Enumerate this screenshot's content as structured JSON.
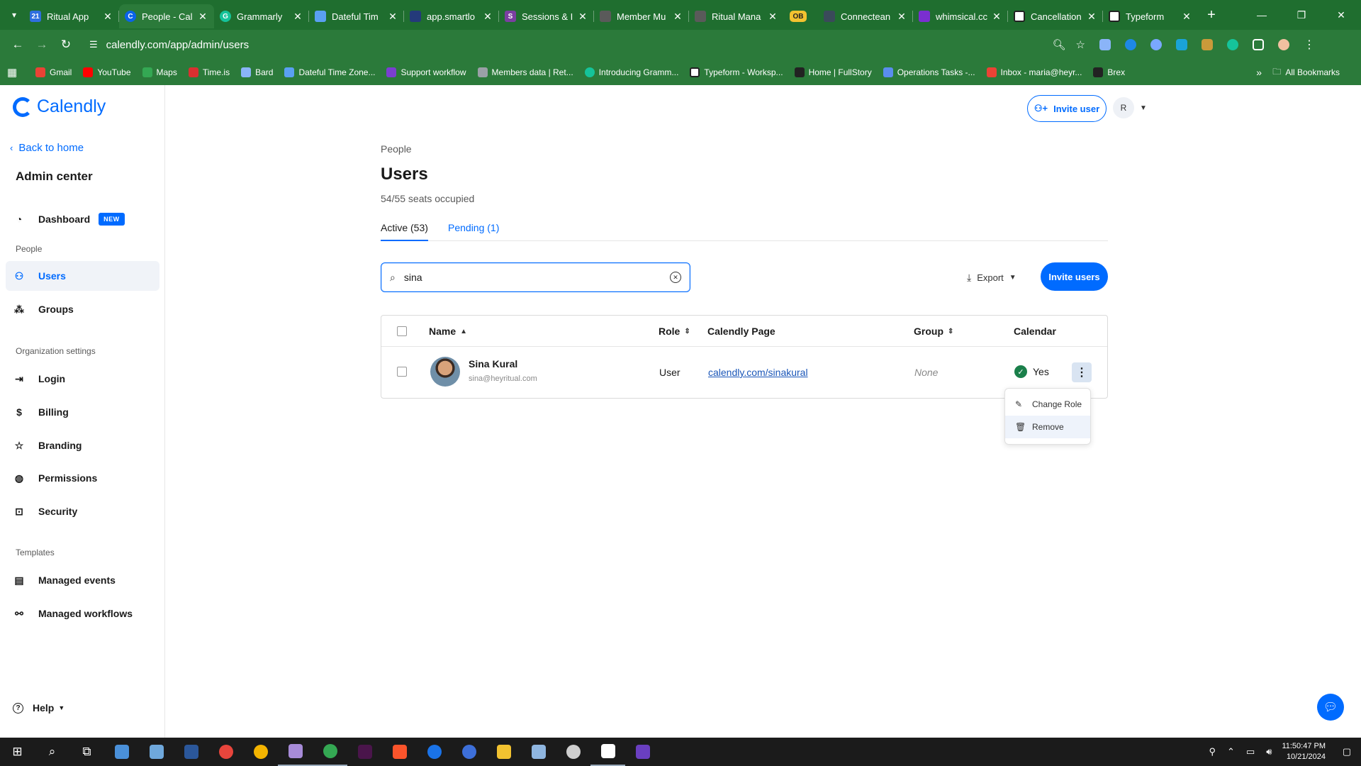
{
  "browser": {
    "tabs": [
      {
        "label": "Ritual App",
        "color": "#2f6fde"
      },
      {
        "label": "People - Cal",
        "color": "#0a63e8",
        "active": true
      },
      {
        "label": "Grammarly",
        "color": "#15c39a"
      },
      {
        "label": "Dateful Tim",
        "color": "#5aa0f2"
      },
      {
        "label": "app.smartlo",
        "color": "#243a7a"
      },
      {
        "label": "Sessions & I",
        "color": "#7a3fa0"
      },
      {
        "label": "Member Mu",
        "color": "#5a5a5a"
      },
      {
        "label": "Ritual Mana",
        "color": "#5a5a5a"
      },
      {
        "label": "OB",
        "color": "#f2c230"
      },
      {
        "label": "Connectean",
        "color": "#3a4a5a"
      },
      {
        "label": "whimsical.cc",
        "color": "#7a2fd0"
      },
      {
        "label": "Cancellation",
        "color": "#222222"
      },
      {
        "label": "Typeform",
        "color": "#222222"
      }
    ],
    "url": "calendly.com/app/admin/users",
    "bookmarks": [
      {
        "label": "Gmail",
        "color": "#ea4335"
      },
      {
        "label": "YouTube",
        "color": "#ff0000"
      },
      {
        "label": "Maps",
        "color": "#34a853"
      },
      {
        "label": "Time.is",
        "color": "#d93030"
      },
      {
        "label": "Bard",
        "color": "#8ab4f8"
      },
      {
        "label": "Dateful Time Zone...",
        "color": "#5aa0f2"
      },
      {
        "label": "Support workflow",
        "color": "#7a3fd0"
      },
      {
        "label": "Members data | Ret...",
        "color": "#9aa0a6"
      },
      {
        "label": "Introducing Gramm...",
        "color": "#15c39a"
      },
      {
        "label": "Typeform - Worksp...",
        "color": "#222222"
      },
      {
        "label": "Home | FullStory",
        "color": "#222222"
      },
      {
        "label": "Operations Tasks -...",
        "color": "#5a8dee"
      },
      {
        "label": "Inbox - maria@heyr...",
        "color": "#ea4335"
      },
      {
        "label": "Brex",
        "color": "#222222"
      }
    ],
    "all_bookmarks": "All Bookmarks"
  },
  "sidebar": {
    "brand": "Calendly",
    "back_label": "Back to home",
    "title": "Admin center",
    "dashboard": {
      "label": "Dashboard",
      "badge": "NEW"
    },
    "section_people": "People",
    "users": "Users",
    "groups": "Groups",
    "section_org": "Organization settings",
    "login": "Login",
    "billing": "Billing",
    "branding": "Branding",
    "permissions": "Permissions",
    "security": "Security",
    "section_templates": "Templates",
    "managed_events": "Managed events",
    "managed_workflows": "Managed workflows",
    "help": "Help"
  },
  "header": {
    "invite_user": "Invite user",
    "avatar_initial": "R"
  },
  "main": {
    "breadcrumb": "People",
    "title": "Users",
    "seats": "54/55 seats occupied",
    "tabs": {
      "active": "Active (53)",
      "pending": "Pending (1)"
    },
    "search_value": "sina",
    "export": "Export",
    "invite_users": "Invite users",
    "columns": {
      "name": "Name",
      "role": "Role",
      "page": "Calendly Page",
      "group": "Group",
      "calendar": "Calendar"
    },
    "rows": [
      {
        "name": "Sina Kural",
        "email": "sina@heyritual.com",
        "role": "User",
        "page": "calendly.com/sinakural",
        "group": "None",
        "calendar": "Yes"
      }
    ],
    "row_menu": {
      "change_role": "Change Role",
      "remove": "Remove"
    }
  },
  "taskbar": {
    "time": "11:50:47 PM",
    "date": "10/21/2024"
  },
  "colors": {
    "accent": "#006bff",
    "chrome": "#2b7a3a",
    "success": "#1a7f4a"
  }
}
